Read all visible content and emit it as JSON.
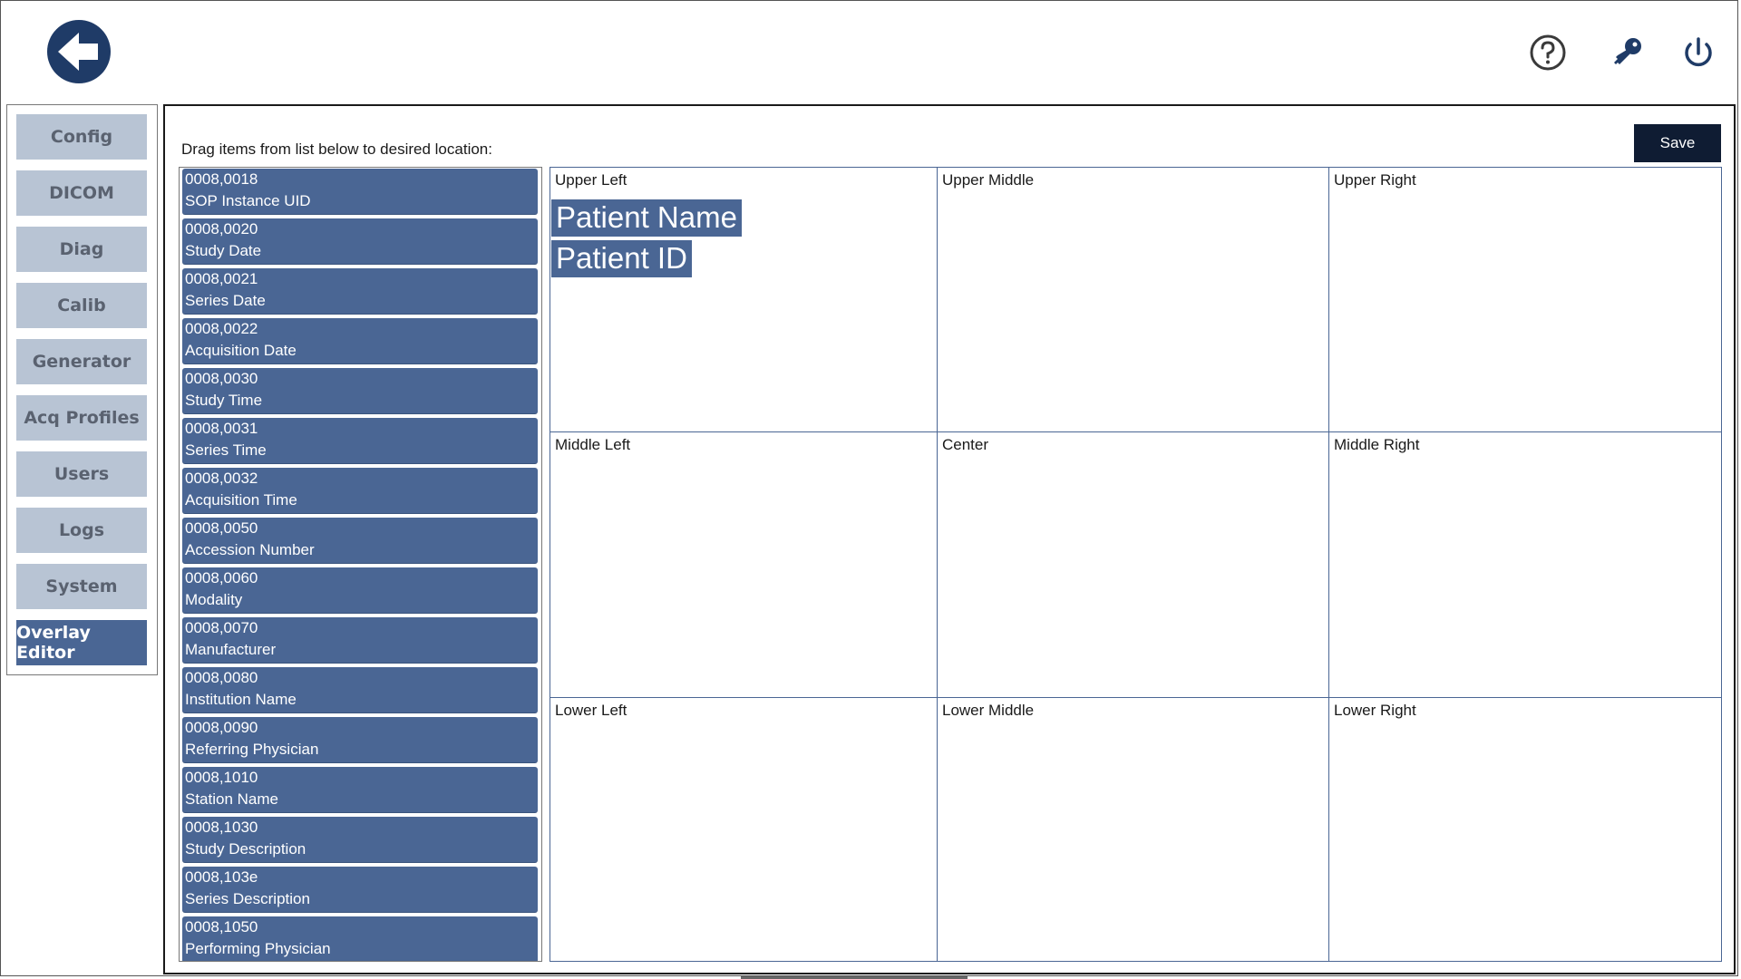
{
  "header": {
    "back_icon": "back-arrow-icon",
    "help_icon": "help-circle-icon",
    "key_icon": "key-icon",
    "power_icon": "power-icon",
    "accent_color": "#1f3b67"
  },
  "sidebar": {
    "items": [
      {
        "label": "Config",
        "active": false
      },
      {
        "label": "DICOM",
        "active": false
      },
      {
        "label": "Diag",
        "active": false
      },
      {
        "label": "Calib",
        "active": false
      },
      {
        "label": "Generator",
        "active": false
      },
      {
        "label": "Acq Profiles",
        "active": false
      },
      {
        "label": "Users",
        "active": false
      },
      {
        "label": "Logs",
        "active": false
      },
      {
        "label": "System",
        "active": false
      },
      {
        "label": "Overlay Editor",
        "active": true
      }
    ]
  },
  "editor": {
    "instruction": "Drag items from list below to desired location:",
    "save_label": "Save",
    "tags": [
      {
        "code": "0008,0018",
        "name": "SOP Instance UID"
      },
      {
        "code": "0008,0020",
        "name": "Study Date"
      },
      {
        "code": "0008,0021",
        "name": "Series Date"
      },
      {
        "code": "0008,0022",
        "name": "Acquisition Date"
      },
      {
        "code": "0008,0030",
        "name": "Study Time"
      },
      {
        "code": "0008,0031",
        "name": "Series Time"
      },
      {
        "code": "0008,0032",
        "name": "Acquisition Time"
      },
      {
        "code": "0008,0050",
        "name": "Accession Number"
      },
      {
        "code": "0008,0060",
        "name": "Modality"
      },
      {
        "code": "0008,0070",
        "name": "Manufacturer"
      },
      {
        "code": "0008,0080",
        "name": "Institution Name"
      },
      {
        "code": "0008,0090",
        "name": "Referring Physician"
      },
      {
        "code": "0008,1010",
        "name": "Station Name"
      },
      {
        "code": "0008,1030",
        "name": "Study Description"
      },
      {
        "code": "0008,103e",
        "name": "Series Description"
      },
      {
        "code": "0008,1050",
        "name": "Performing Physician"
      }
    ],
    "cells": [
      {
        "title": "Upper Left",
        "items": [
          "Patient Name",
          "Patient ID"
        ]
      },
      {
        "title": "Upper Middle",
        "items": []
      },
      {
        "title": "Upper Right",
        "items": []
      },
      {
        "title": "Middle Left",
        "items": []
      },
      {
        "title": "Center",
        "items": []
      },
      {
        "title": "Middle Right",
        "items": []
      },
      {
        "title": "Lower Left",
        "items": []
      },
      {
        "title": "Lower Middle",
        "items": []
      },
      {
        "title": "Lower Right",
        "items": []
      }
    ]
  }
}
